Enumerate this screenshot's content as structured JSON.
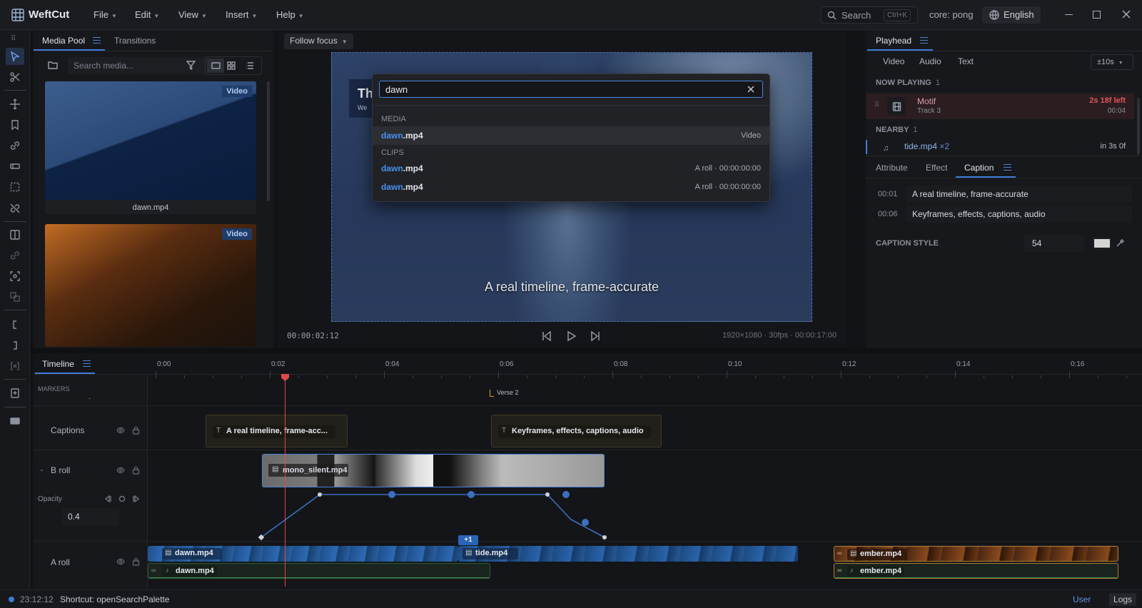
{
  "app": {
    "name": "WeftCut"
  },
  "menu": [
    {
      "label": "File"
    },
    {
      "label": "Edit"
    },
    {
      "label": "View"
    },
    {
      "label": "Insert"
    },
    {
      "label": "Help"
    }
  ],
  "topbar": {
    "search_label": "Search",
    "search_shortcut": "Ctrl+K",
    "core": "core: pong",
    "language": "English"
  },
  "media_pool": {
    "tabs": [
      {
        "label": "Media Pool"
      },
      {
        "label": "Transitions"
      }
    ],
    "search_placeholder": "Search media...",
    "items": [
      {
        "name": "dawn.mp4",
        "badge": "Video"
      },
      {
        "name": "",
        "badge": "Video"
      }
    ]
  },
  "viewer": {
    "follow_label": "Follow focus",
    "caption": "A real timeline, frame-accurate",
    "title_fragment": "Th",
    "sub_fragment": "We",
    "timecode": "00:00:02:12",
    "info": "1920×1080 · 30fps · 00:00:17:00"
  },
  "palette": {
    "query": "dawn",
    "section_media": "MEDIA",
    "section_clips": "CLIPS",
    "media_results": [
      {
        "match": "dawn",
        "rest": ".mp4",
        "meta": "Video"
      }
    ],
    "clip_results": [
      {
        "match": "dawn",
        "rest": ".mp4",
        "meta": "A roll · 00:00:00:00"
      },
      {
        "match": "dawn",
        "rest": ".mp4",
        "meta": "A roll · 00:00:00:00"
      }
    ]
  },
  "right_panel": {
    "tab": "Playhead",
    "filters": [
      "Video",
      "Audio",
      "Text"
    ],
    "range": "±10s",
    "now_playing_label": "NOW PLAYING",
    "now_playing_count": "1",
    "now_item": {
      "name": "Motif",
      "track": "Track 3",
      "remaining": "2s 18f left",
      "time": "00:04"
    },
    "nearby_label": "NEARBY",
    "nearby_count": "1",
    "nearby_item": {
      "name": "tide.mp4",
      "mult": "×2",
      "when": "in 3s 0f"
    },
    "inspector_tabs": [
      {
        "label": "Attribute"
      },
      {
        "label": "Effect"
      },
      {
        "label": "Caption"
      }
    ],
    "captions": [
      {
        "time": "00:01",
        "text": "A real timeline, frame-accurate"
      },
      {
        "time": "00:06",
        "text": "Keyframes, effects, captions, audio"
      }
    ],
    "caption_style_label": "CAPTION STYLE",
    "caption_size": "54"
  },
  "timeline": {
    "tab": "Timeline",
    "ruler": [
      "0:00",
      "0:02",
      "0:04",
      "0:06",
      "0:08",
      "0:10",
      "0:12",
      "0:14",
      "0:16"
    ],
    "markers_label": "MARKERS",
    "marker": "Verse 2",
    "tracks": [
      {
        "name": "Captions"
      },
      {
        "name": "B roll"
      },
      {
        "name": "A roll"
      }
    ],
    "opacity_label": "Opacity",
    "opacity_value": "0.4",
    "caption_clips": [
      "A real timeline, frame-acc...",
      "Keyframes, effects, captions, audio"
    ],
    "broll_clip": "mono_silent.mp4",
    "aroll_video": [
      "dawn.mp4",
      "tide.mp4",
      "ember.mp4"
    ],
    "aroll_audio": [
      "dawn.mp4",
      "ember.mp4"
    ],
    "overlap_badge": "+1"
  },
  "status": {
    "time": "23:12:12",
    "message": "Shortcut: openSearchPalette",
    "user": "User",
    "logs": "Logs"
  },
  "colors": {
    "accent": "#3e7bd8",
    "playhead": "#e04848",
    "match": "#4b8ff0"
  }
}
